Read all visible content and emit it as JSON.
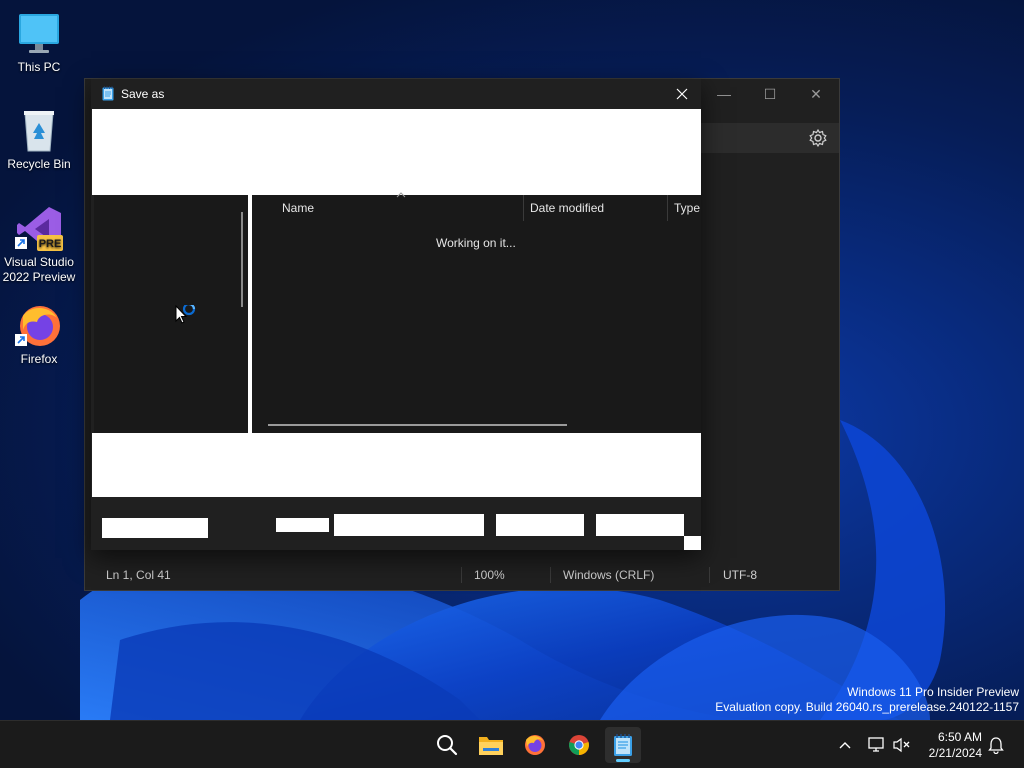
{
  "desktop": {
    "icons": [
      {
        "label": "This PC",
        "icon": "monitor-icon"
      },
      {
        "label": "Recycle Bin",
        "icon": "recycle-bin-icon"
      },
      {
        "label": "Visual Studio 2022 Preview",
        "line1": "Visual Studio",
        "line2": "2022 Preview",
        "badge": "PRE",
        "icon": "visual-studio-icon"
      },
      {
        "label": "Firefox",
        "icon": "firefox-icon"
      }
    ]
  },
  "watermark": {
    "line1": "Windows 11 Pro Insider Preview",
    "line2": "Evaluation copy. Build 26040.rs_prerelease.240122-1157"
  },
  "notepad": {
    "status": {
      "position": "Ln 1, Col 41",
      "zoom": "100%",
      "line_ending": "Windows (CRLF)",
      "encoding": "UTF-8"
    },
    "caption_buttons": {
      "minimize": "—",
      "maximize": "☐",
      "close": "✕"
    }
  },
  "save_dialog": {
    "title": "Save as",
    "columns": {
      "name": "Name",
      "date_modified": "Date modified",
      "type": "Type"
    },
    "loading_text": "Working on it..."
  },
  "taskbar": {
    "apps": [
      "search-icon",
      "file-explorer-icon",
      "firefox-icon",
      "chrome-icon",
      "notepad-icon"
    ],
    "clock": {
      "time": "6:50 AM",
      "date": "2/21/2024"
    }
  },
  "colors": {
    "accent": "#60cdff",
    "window_bg": "#202020",
    "taskbar_bg": "#1b1b1b"
  }
}
